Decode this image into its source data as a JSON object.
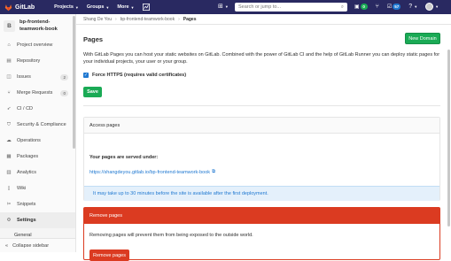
{
  "topbar": {
    "logo_text": "GitLab",
    "nav": [
      {
        "label": "Projects"
      },
      {
        "label": "Groups"
      },
      {
        "label": "More"
      }
    ],
    "search_placeholder": "Search or jump to...",
    "issues_count": "0",
    "todos_count": "57",
    "colors": {
      "bg": "#292961",
      "todos_badge": "#1f78d1",
      "issues_badge": "#1aaa55"
    }
  },
  "sidebar": {
    "project_initial": "B",
    "project_name_line1": "bp-frontend-",
    "project_name_line2": "teamwork-book",
    "items": [
      {
        "label": "Project overview",
        "icon": "home-icon"
      },
      {
        "label": "Repository",
        "icon": "doc-icon"
      },
      {
        "label": "Issues",
        "icon": "issues-icon",
        "count": "2"
      },
      {
        "label": "Merge Requests",
        "icon": "merge-icon",
        "count": "0"
      },
      {
        "label": "CI / CD",
        "icon": "rocket-icon"
      },
      {
        "label": "Security & Compliance",
        "icon": "shield-icon"
      },
      {
        "label": "Operations",
        "icon": "cloud-icon"
      },
      {
        "label": "Packages",
        "icon": "package-icon"
      },
      {
        "label": "Analytics",
        "icon": "chart-icon"
      },
      {
        "label": "Wiki",
        "icon": "book-icon"
      },
      {
        "label": "Snippets",
        "icon": "scissors-icon"
      },
      {
        "label": "Settings",
        "icon": "gear-icon"
      }
    ],
    "sub_item": "General",
    "collapse_label": "Collapse sidebar"
  },
  "breadcrumb": [
    "Shang De You",
    "bp-frontend-teamwork-book",
    "Pages"
  ],
  "main": {
    "title": "Pages",
    "new_domain": "New Domain",
    "description": "With GitLab Pages you can host your static websites on GitLab. Combined with the power of GitLab CI and the help of GitLab Runner you can deploy static pages for your individual projects, your user or your group.",
    "https_label": "Force HTTPS (requires valid certificates)",
    "save": "Save",
    "access_header": "Access pages",
    "served_label": "Your pages are served under:",
    "pages_url": "https://shangdeyou.gitlab.io/bp-frontend-teamwork-book",
    "info_text": "It may take up to 30 minutes before the site is available after the first deployment.",
    "remove_header": "Remove pages",
    "remove_text": "Removing pages will prevent them from being exposed to the outside world.",
    "remove_button": "Remove pages",
    "colors": {
      "green": "#1aaa55",
      "red": "#db3b21",
      "blue": "#1f78d1"
    }
  }
}
